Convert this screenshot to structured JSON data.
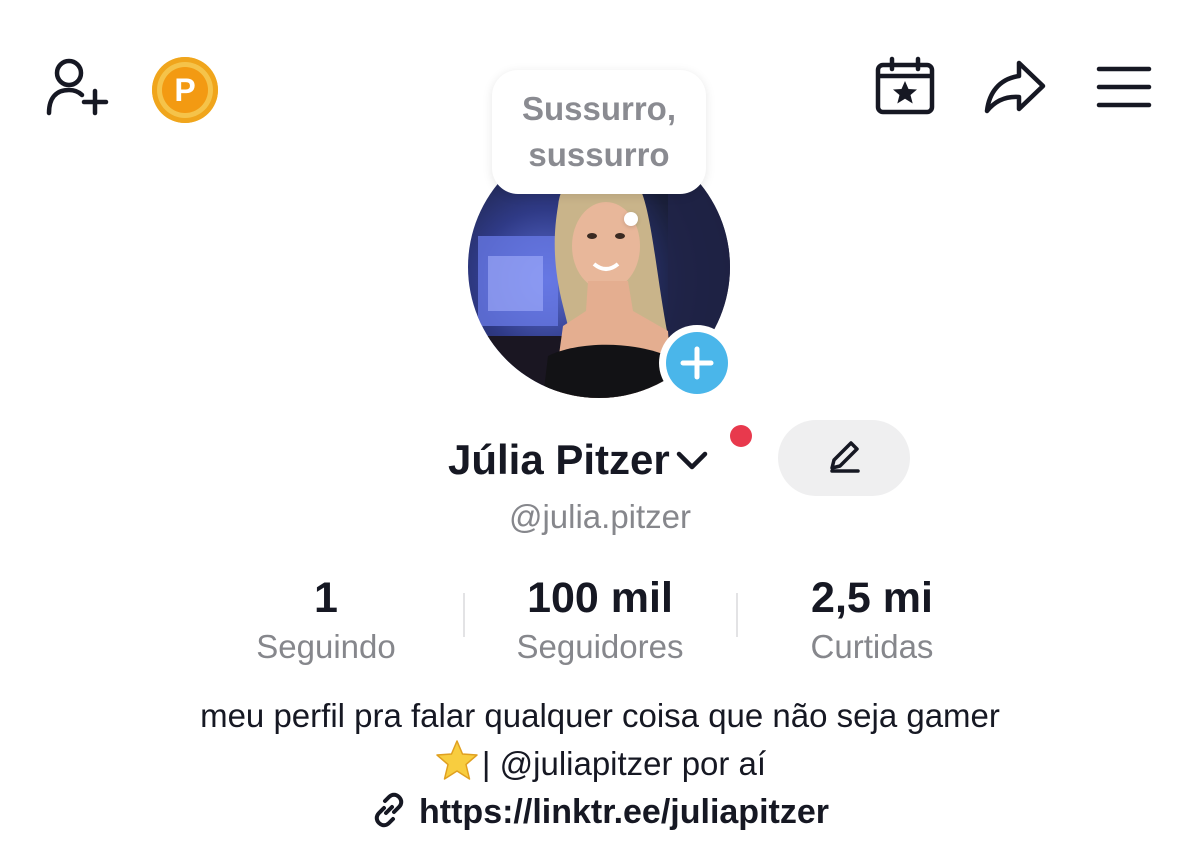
{
  "topbar": {
    "add_friend_icon": "person-add-icon",
    "coin_icon": "coin-icon",
    "coin_letter": "P",
    "calendar_icon": "calendar-star-icon",
    "share_icon": "share-arrow-icon",
    "menu_icon": "hamburger-menu-icon"
  },
  "profile": {
    "thought_bubble": "Sussurro,\nsussurro",
    "avatar_icon": "avatar-photo",
    "add_icon": "plus-icon",
    "name": "Júlia Pitzer",
    "name_dropdown_icon": "chevron-down-icon",
    "edit_icon": "pencil-icon",
    "handle": "@julia.pitzer"
  },
  "stats": [
    {
      "value": "1",
      "label": "Seguindo"
    },
    {
      "value": "100 mil",
      "label": "Seguidores"
    },
    {
      "value": "2,5 mi",
      "label": "Curtidas"
    }
  ],
  "bio": {
    "line1": "meu perfil pra falar qualquer coisa que não seja gamer",
    "line2": "| @juliapitzer por aí",
    "star_icon": "star-emoji-icon",
    "link_icon": "link-icon",
    "link": "https://linktr.ee/juliapitzer"
  },
  "colors": {
    "accent_blue": "#4ab6ea",
    "notification_red": "#e8394d",
    "coin_gold": "#f39a12",
    "text_primary": "#161823",
    "text_secondary": "#86878c"
  }
}
